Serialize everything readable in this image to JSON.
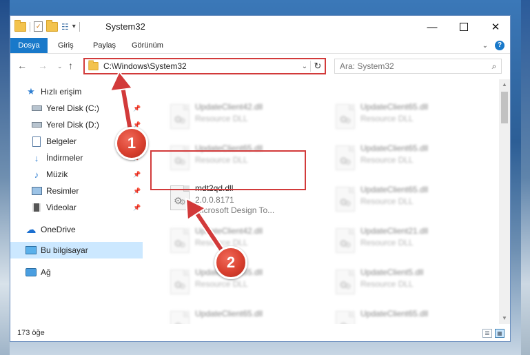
{
  "window": {
    "title": "System32",
    "minimize_glyph": "—",
    "close_glyph": "✕"
  },
  "quick_access_toolbar": {
    "dropdown_glyph": "▾"
  },
  "ribbon": {
    "tabs": [
      {
        "label": "Dosya",
        "active": true
      },
      {
        "label": "Giriş"
      },
      {
        "label": "Paylaş"
      },
      {
        "label": "Görünüm"
      }
    ],
    "expand_glyph": "⌄",
    "help_glyph": "?",
    "accent_color": "#1979ca"
  },
  "navigation": {
    "back_glyph": "←",
    "forward_glyph": "→",
    "recent_glyph": "⌄",
    "up_glyph": "↑",
    "address": "C:\\Windows\\System32",
    "address_dropdown_glyph": "⌄",
    "refresh_glyph": "↻",
    "search_placeholder": "Ara: System32",
    "search_glyph": "⌕"
  },
  "sidebar": {
    "items": [
      {
        "label": "Hızlı erişim",
        "icon": "star-icon",
        "pinned": false
      },
      {
        "label": "Yerel Disk (C:)",
        "icon": "drive-icon",
        "pinned": true
      },
      {
        "label": "Yerel Disk (D:)",
        "icon": "drive-icon",
        "pinned": true
      },
      {
        "label": "Belgeler",
        "icon": "documents-icon",
        "pinned": true
      },
      {
        "label": "İndirmeler",
        "icon": "downloads-icon",
        "pinned": true
      },
      {
        "label": "Müzik",
        "icon": "music-icon",
        "pinned": true
      },
      {
        "label": "Resimler",
        "icon": "pictures-icon",
        "pinned": true
      },
      {
        "label": "Videolar",
        "icon": "videos-icon",
        "pinned": true
      },
      {
        "label": "OneDrive",
        "icon": "cloud-icon",
        "pinned": false
      },
      {
        "label": "Bu bilgisayar",
        "icon": "computer-icon",
        "pinned": false,
        "selected": true
      },
      {
        "label": "Ağ",
        "icon": "network-icon",
        "pinned": false
      }
    ],
    "pin_glyph": "📌"
  },
  "files": [
    {
      "name": "UpdateClient42.dll",
      "type": "Resource DLL",
      "blurred": true
    },
    {
      "name": "UpdateClient65.dll",
      "type": "Resource DLL",
      "blurred": true
    },
    {
      "name": "UpdateClient65.dll",
      "type": "Resource DLL",
      "blurred": true
    },
    {
      "name": "UpdateClient65.dll",
      "type": "Resource DLL",
      "blurred": true
    },
    {
      "name": "mdt2qd.dll",
      "version": "2.0.0.8171",
      "type": "Microsoft Design To...",
      "blurred": false,
      "highlighted": true
    },
    {
      "name": "UpdateClient65.dll",
      "type": "Resource DLL",
      "blurred": true
    },
    {
      "name": "UpdateClient42.dll",
      "type": "Resource DLL",
      "blurred": true
    },
    {
      "name": "UpdateClient21.dll",
      "type": "Resource DLL",
      "blurred": true
    },
    {
      "name": "UpdateClient65.dll",
      "type": "Resource DLL",
      "blurred": true
    },
    {
      "name": "UpdateClient5.dll",
      "type": "Resource DLL",
      "blurred": true
    },
    {
      "name": "UpdateClient65.dll",
      "type": "Resource DLL",
      "blurred": true
    },
    {
      "name": "UpdateClient65.dll",
      "type": "Resource DLL",
      "blurred": true
    }
  ],
  "scrollbar": {
    "up_glyph": "▲",
    "down_glyph": "▼"
  },
  "status": {
    "item_count": "173 öğe"
  },
  "view_buttons": {
    "details_glyph": "☰",
    "tiles_glyph": "▦"
  },
  "annotations": {
    "marker_1": "1",
    "marker_2": "2",
    "color": "#d23a3a"
  }
}
